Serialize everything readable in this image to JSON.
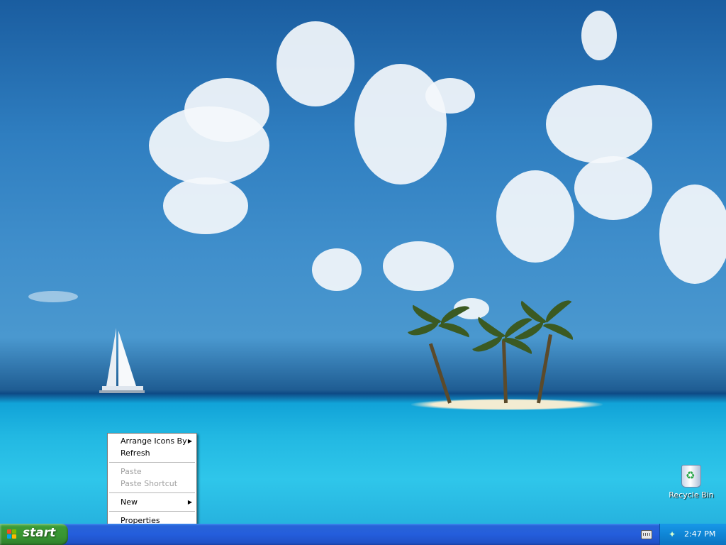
{
  "desktop": {
    "icons": [
      {
        "label": "Recycle Bin",
        "icon": "recycle-bin-icon"
      }
    ]
  },
  "context_menu": {
    "items": [
      {
        "label": "Arrange Icons By",
        "submenu": true,
        "enabled": true
      },
      {
        "label": "Refresh",
        "submenu": false,
        "enabled": true
      },
      {
        "label": "Paste",
        "submenu": false,
        "enabled": false
      },
      {
        "label": "Paste Shortcut",
        "submenu": false,
        "enabled": false
      },
      {
        "label": "New",
        "submenu": true,
        "enabled": true
      },
      {
        "label": "Properties",
        "submenu": false,
        "enabled": true
      }
    ]
  },
  "taskbar": {
    "start_label": "start",
    "clock": "2:47 PM"
  },
  "colors": {
    "taskbar_blue": "#245edc",
    "start_green": "#3c9b35",
    "tray_blue": "#0f86d6",
    "disabled_text": "#a0a0a0"
  }
}
